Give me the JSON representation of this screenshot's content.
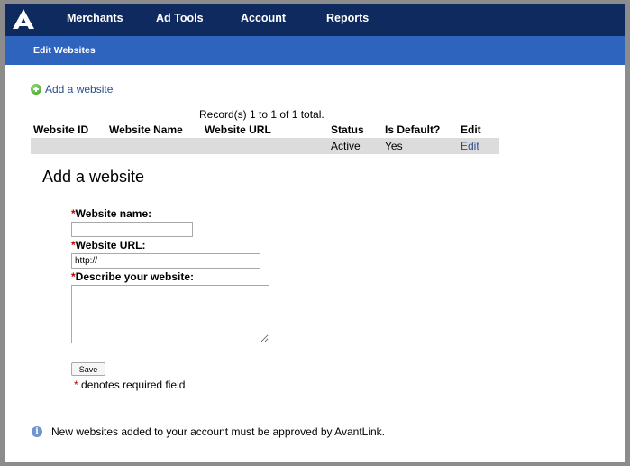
{
  "nav": {
    "items": [
      "Merchants",
      "Ad Tools",
      "Account",
      "Reports"
    ]
  },
  "subnav": {
    "active": "Edit Websites"
  },
  "add_link": {
    "icon": "plus-circle-icon",
    "label": "Add a website"
  },
  "records": {
    "summary": "Record(s) 1 to 1 of 1 total.",
    "columns": [
      "Website ID",
      "Website Name",
      "Website URL",
      "Status",
      "Is Default?",
      "Edit"
    ],
    "rows": [
      {
        "website_id": "",
        "website_name": "",
        "website_url": "",
        "status": "Active",
        "is_default": "Yes",
        "edit": "Edit"
      }
    ]
  },
  "form": {
    "legend": "Add a website",
    "required_marker": "*",
    "name_label": "Website name:",
    "name_value": "",
    "url_label": "Website URL:",
    "url_value": "http://",
    "describe_label": "Describe your website:",
    "describe_value": "",
    "save_label": "Save",
    "required_note": "denotes required field"
  },
  "info": {
    "icon": "info-icon",
    "text": "New websites added to your account must be approved by AvantLink."
  },
  "colors": {
    "topnav": "#0e2a5e",
    "subnav": "#2f64be",
    "link": "#2a4d8f",
    "required": "#c00000",
    "row_bg": "#dcdcdc"
  }
}
